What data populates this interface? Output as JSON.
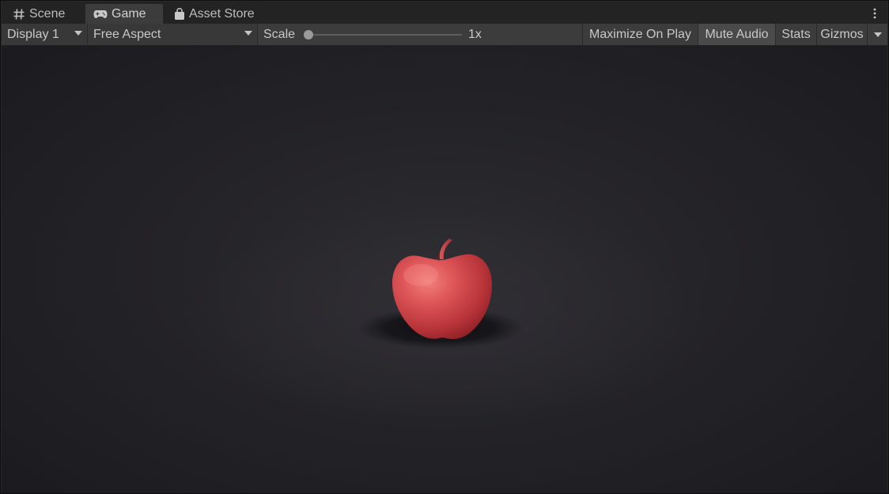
{
  "tabs": [
    {
      "label": "Scene",
      "icon": "grid-icon",
      "active": false
    },
    {
      "label": "Game",
      "icon": "gamepad-icon",
      "active": true
    },
    {
      "label": "Asset Store",
      "icon": "shopping-bag-icon",
      "active": false
    }
  ],
  "toolbar": {
    "display": {
      "selected": "Display 1"
    },
    "aspect": {
      "selected": "Free Aspect"
    },
    "scale": {
      "label": "Scale",
      "value": "1x",
      "slider_level": 0
    },
    "maximize_on_play": "Maximize On Play",
    "mute_audio": "Mute Audio",
    "stats": "Stats",
    "gizmos": "Gizmos"
  },
  "icons": {
    "more": "kebab-menu-icon",
    "gizmos_menu": "chevron-down-icon"
  },
  "colors": {
    "apple": "#d2464a",
    "apple_highlight": "#f27f7c",
    "apple_shadow": "#8e2026",
    "stem": "#c7484b"
  }
}
